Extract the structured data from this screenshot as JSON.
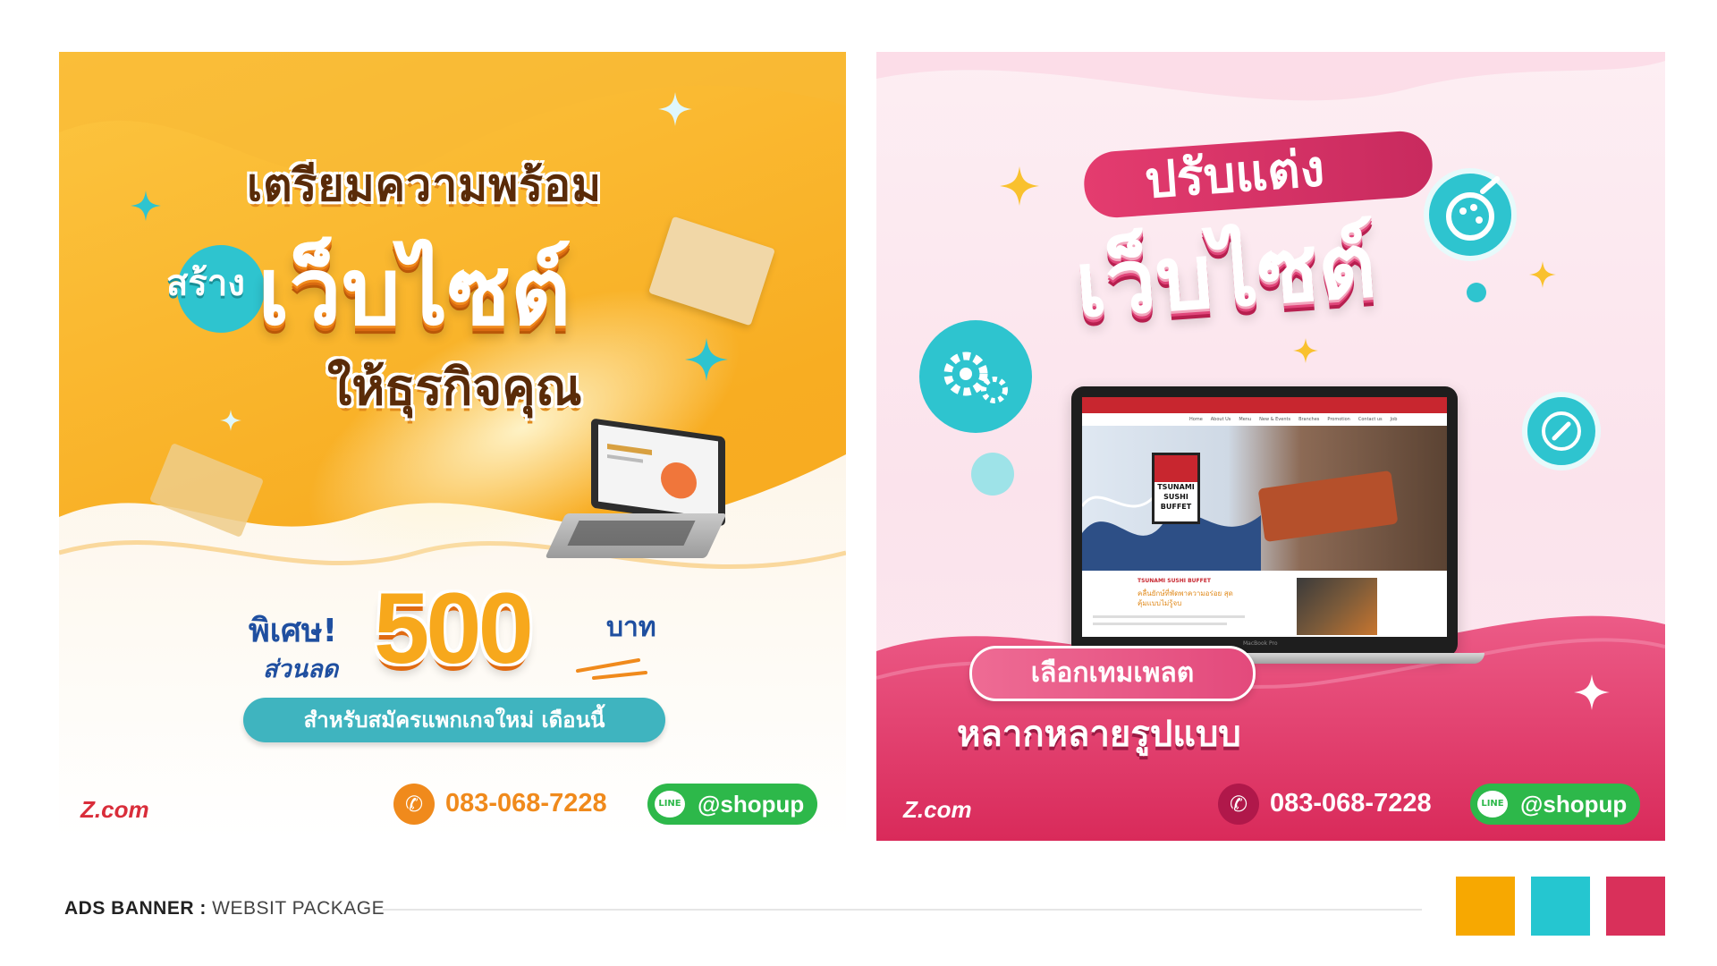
{
  "left_banner": {
    "line1": "เตรียมความพร้อม",
    "line2_small": "สร้าง",
    "line2_big": "เว็บไซต์",
    "line3": "ให้ธุรกิจคุณ",
    "promo_special": "พิเศษ!",
    "promo_discount": "ส่วนลด",
    "promo_amount": "500",
    "promo_currency": "บาท",
    "promo_note": "สำหรับสมัครแพกเกจใหม่ เดือนนี้",
    "logo": "Z.com",
    "phone": "083-068-7228",
    "line_tag": "LINE",
    "line_id": "@shopup"
  },
  "right_banner": {
    "line1": "ปรับแต่ง",
    "line2": "เว็บไซต์",
    "laptop_site_title": "TSUNAMI SUSHI BUFFET",
    "laptop_logo_line1": "TSUNAMI",
    "laptop_logo_line2": "SUSHI",
    "laptop_logo_line3": "BUFFET",
    "laptop_tagline": "คลื่นยักษ์ที่พัดพาความอร่อย สุดคุ้มแบบไม่รู้จบ",
    "laptop_brand": "MacBook Pro",
    "laptop_nav": [
      "Home",
      "About Us",
      "Menu",
      "New & Events",
      "Branches",
      "Promotion",
      "Contact us",
      "Job"
    ],
    "tag_pill": "เลือกเทมเพลต",
    "tag_line2": "หลากหลายรูปแบบ",
    "logo": "Z.com",
    "phone": "083-068-7228",
    "line_tag": "LINE",
    "line_id": "@shopup"
  },
  "caption": {
    "bold": "ADS BANNER :",
    "rest": " WEBSIT PACKAGE"
  },
  "palette": [
    "#f7a801",
    "#25c6d0",
    "#d9305a"
  ]
}
